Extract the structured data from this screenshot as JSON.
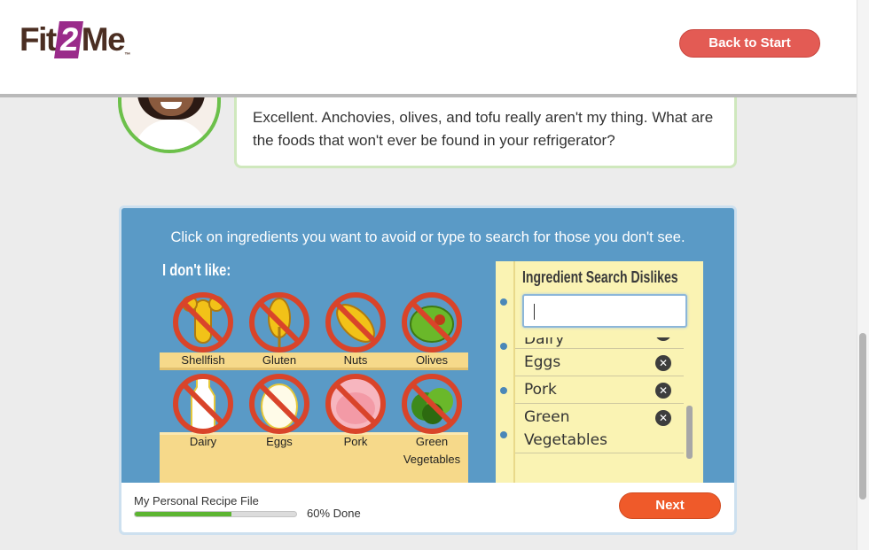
{
  "header": {
    "logo_pre": "Fit",
    "logo_num": "2",
    "logo_post": "Me",
    "logo_tm": "™",
    "back_label": "Back to Start"
  },
  "chat": {
    "message": "Excellent. Anchovies, olives, and tofu really aren't my thing. What are the foods that won't ever be found in your refrigerator?"
  },
  "panel": {
    "instruction": "Click on ingredients you want to avoid or type to search for those you don't see.",
    "dislike_label": "I don't like:",
    "foods": [
      {
        "label": "Shellfish",
        "icon": "shellfish-icon"
      },
      {
        "label": "Gluten",
        "icon": "wheat-icon"
      },
      {
        "label": "Nuts",
        "icon": "peanut-icon"
      },
      {
        "label": "Olives",
        "icon": "olive-icon"
      },
      {
        "label": "Dairy",
        "icon": "milk-icon"
      },
      {
        "label": "Eggs",
        "icon": "egg-icon"
      },
      {
        "label": "Pork",
        "icon": "pig-icon"
      },
      {
        "label": "Green Vegetables",
        "icon": "greens-icon"
      }
    ]
  },
  "notepad": {
    "title": "Ingredient Search Dislikes",
    "search_value": "",
    "items": [
      {
        "label": "Dairy"
      },
      {
        "label": "Eggs"
      },
      {
        "label": "Pork"
      },
      {
        "label": "Green Vegetables"
      }
    ]
  },
  "footer": {
    "recipe_label": "My Personal Recipe File",
    "progress": 0.6,
    "progress_text": "60% Done",
    "next_label": "Next"
  },
  "colors": {
    "accent_red": "#e35b54",
    "next_orange": "#ef5a2a",
    "panel_blue": "#5a9ac6",
    "progress_green": "#5cb531",
    "ban_red": "#d9442a"
  }
}
